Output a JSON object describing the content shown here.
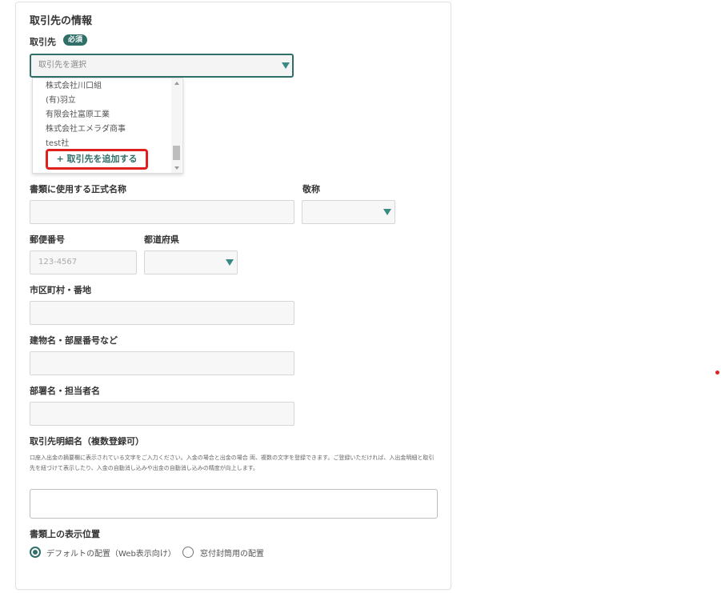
{
  "section": {
    "title": "取引先の情報"
  },
  "partner": {
    "label": "取引先",
    "required_badge": "必須",
    "placeholder": "取引先を選択",
    "options": [
      "株式会社川口組",
      "(有)羽立",
      "有限会社富原工業",
      "株式会社エメラダ商事",
      "test社"
    ],
    "add_label": "+ 取引先を追加する"
  },
  "official_name": {
    "label": "書類に使用する正式名称"
  },
  "honorific": {
    "label": "敬称"
  },
  "postal": {
    "label": "郵便番号",
    "placeholder": "123-4567"
  },
  "prefecture": {
    "label": "都道府県"
  },
  "city": {
    "label": "市区町村・番地"
  },
  "building": {
    "label": "建物名・部屋番号など"
  },
  "department": {
    "label": "部署名・担当者名"
  },
  "detail_names": {
    "label": "取引先明細名（複数登録可）",
    "description": "口座入出金の摘要欄に表示されている文字をご入力ください。入金の場合と出金の場合 両、複数の文字を登録できます。ご登録いただければ、入出金明細と取引先を紐づけて表示したり、入金の自動消し込みや出金の自動消し込みの精度が向上します。"
  },
  "display_position": {
    "label": "書類上の表示位置",
    "options": [
      {
        "label": "デフォルトの配置（Web表示向け）",
        "selected": true
      },
      {
        "label": "窓付封筒用の配置",
        "selected": false
      }
    ]
  },
  "colors": {
    "accent": "#2f6f68",
    "highlight": "#e0201e"
  }
}
